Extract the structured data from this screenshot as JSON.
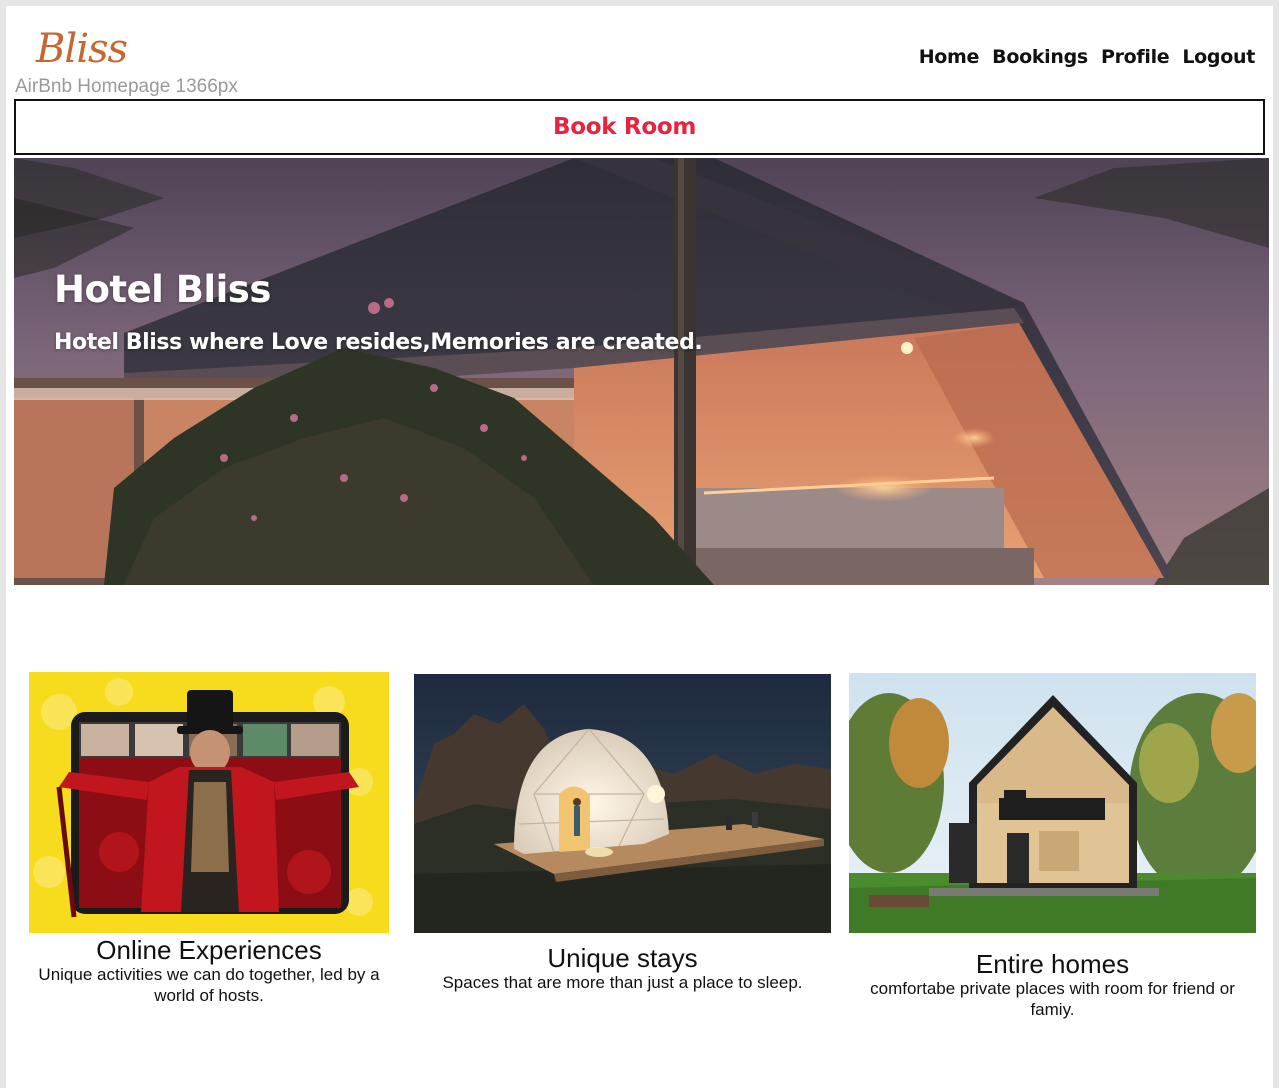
{
  "header": {
    "logo": "Bliss",
    "frame_label": "AirBnb Homepage 1366px",
    "nav": [
      "Home",
      "Bookings",
      "Profile",
      "Logout"
    ]
  },
  "book_bar": {
    "label": "Book Room",
    "color": "#e8233f"
  },
  "hero": {
    "title": "Hotel Bliss",
    "subtitle": "Hotel Bliss where Love resides,Memories are created."
  },
  "cards": [
    {
      "title": "Online Experiences",
      "description": "Unique activities we can do together, led by a world of hosts."
    },
    {
      "title": "Unique stays",
      "description": "Spaces that are more than just a place to sleep."
    },
    {
      "title": "Entire homes",
      "description": "comfortabe private places with room for friend or famiy."
    }
  ],
  "colors": {
    "logo": "#c7662e",
    "accent": "#e8233f"
  }
}
